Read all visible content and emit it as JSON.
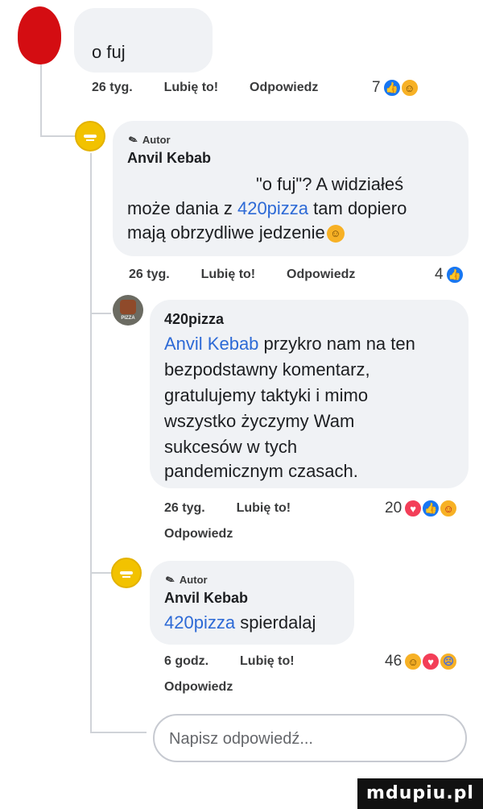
{
  "comment_top": {
    "text": "o fuj",
    "time": "26 tyg.",
    "like_label": "Lubię to!",
    "reply_label": "Odpowiedz",
    "reaction_count": "7",
    "reactions": [
      "like-icon",
      "haha-icon"
    ]
  },
  "reply_1": {
    "author_badge": "Autor",
    "author_name": "Anvil Kebab",
    "text_line_1": "\"o fuj\"? A widziałeś",
    "text_line_2_prefix": "może dania z ",
    "text_line_2_link": "420pizza",
    "text_line_2_suffix": " tam dopiero",
    "text_line_3": "mają obrzydliwe jedzenie",
    "emoji": "smirk-icon",
    "time": "26 tyg.",
    "like_label": "Lubię to!",
    "reply_label": "Odpowiedz",
    "reaction_count": "4",
    "reactions": [
      "like-icon"
    ]
  },
  "reply_2": {
    "author_name": "420pizza",
    "lines": [
      "przykro nam na ten",
      "bezpodstawny komentarz,",
      "gratulujemy taktyki i mimo",
      "wszystko życzymy Wam",
      "sukcesów w tych",
      "pandemicznym czasach."
    ],
    "mention": "Anvil Kebab",
    "time": "26 tyg.",
    "like_label": "Lubię to!",
    "reply_label": "Odpowiedz",
    "reaction_count": "20",
    "reactions": [
      "love-icon",
      "like-icon",
      "care-icon"
    ]
  },
  "reply_3": {
    "author_badge": "Autor",
    "author_name": "Anvil Kebab",
    "mention": "420pizza",
    "text": " spierdalaj",
    "time": "6 godz.",
    "like_label": "Lubię to!",
    "reply_label": "Odpowiedz",
    "reaction_count": "46",
    "reactions": [
      "haha-icon",
      "love-icon",
      "sad-icon"
    ]
  },
  "reply_input": {
    "placeholder": "Napisz odpowiedź..."
  },
  "watermark": "mdupiu.pl",
  "colors": {
    "bubble": "#f0f2f5",
    "link": "#2d6ad6",
    "like": "#1877f2",
    "love": "#f33e58",
    "haha": "#f7b125"
  }
}
